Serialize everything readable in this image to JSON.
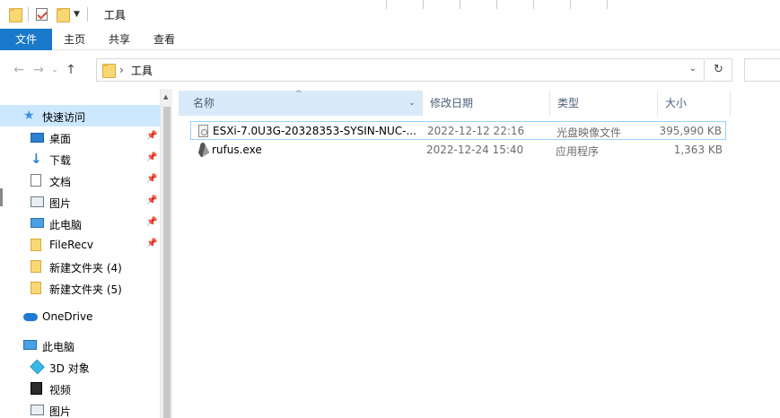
{
  "window": {
    "title": "工具"
  },
  "ribbon": {
    "tabs": [
      {
        "label": "文件"
      },
      {
        "label": "主页"
      },
      {
        "label": "共享"
      },
      {
        "label": "查看"
      }
    ]
  },
  "address": {
    "path": "工具"
  },
  "nav": {
    "items": [
      {
        "label": "快速访问",
        "icon": "star-icon",
        "pinned": false
      },
      {
        "label": "桌面",
        "icon": "desktop-icon",
        "pinned": true
      },
      {
        "label": "下载",
        "icon": "download-icon",
        "pinned": true
      },
      {
        "label": "文档",
        "icon": "document-icon",
        "pinned": true
      },
      {
        "label": "图片",
        "icon": "pictures-icon",
        "pinned": true
      },
      {
        "label": "此电脑",
        "icon": "computer-icon",
        "pinned": true
      },
      {
        "label": "FileRecv",
        "icon": "folder-icon",
        "pinned": true
      },
      {
        "label": "新建文件夹 (4)",
        "icon": "folder-icon",
        "pinned": false
      },
      {
        "label": "新建文件夹 (5)",
        "icon": "folder-icon",
        "pinned": false
      },
      {
        "label": "OneDrive",
        "icon": "onedrive-icon",
        "pinned": false
      },
      {
        "label": "此电脑",
        "icon": "computer-icon",
        "pinned": false
      },
      {
        "label": "3D 对象",
        "icon": "cube-icon",
        "pinned": false
      },
      {
        "label": "视频",
        "icon": "video-icon",
        "pinned": false
      },
      {
        "label": "图片",
        "icon": "pictures-icon",
        "pinned": false
      }
    ]
  },
  "columns": {
    "name": "名称",
    "date": "修改日期",
    "type": "类型",
    "size": "大小"
  },
  "files": [
    {
      "name": "ESXi-7.0U3G-20328353-SYSIN-NUC-...",
      "date": "2022-12-12 22:16",
      "type": "光盘映像文件",
      "size": "395,990 KB",
      "icon": "disc-image-icon"
    },
    {
      "name": "rufus.exe",
      "date": "2022-12-24 15:40",
      "type": "应用程序",
      "size": "1,363 KB",
      "icon": "usb-drive-icon"
    }
  ]
}
